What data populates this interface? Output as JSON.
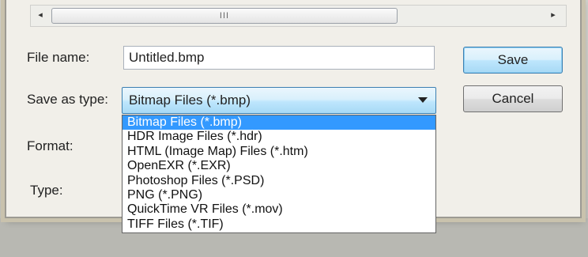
{
  "scrollbar": {
    "left_arrow": "◂",
    "right_arrow": "▸",
    "thumb_grip": "III"
  },
  "form": {
    "file_name_label": "File name:",
    "file_name_value": "Untitled.bmp",
    "save_as_type_label": "Save as type:",
    "save_as_type_value": "Bitmap Files (*.bmp)",
    "format_label": "Format:",
    "type_label": "Type:"
  },
  "buttons": {
    "save": "Save",
    "cancel": "Cancel"
  },
  "dropdown": {
    "options": [
      "Bitmap Files (*.bmp)",
      "HDR Image Files (*.hdr)",
      "HTML (Image Map) Files (*.htm)",
      "OpenEXR (*.EXR)",
      "Photoshop Files (*.PSD)",
      "PNG (*.PNG)",
      "QuickTime VR Files (*.mov)",
      "TIFF Files (*.TIF)"
    ],
    "selected_index": 0
  },
  "colors": {
    "selection": "#3399ff",
    "combo_border": "#3c7fb1"
  }
}
